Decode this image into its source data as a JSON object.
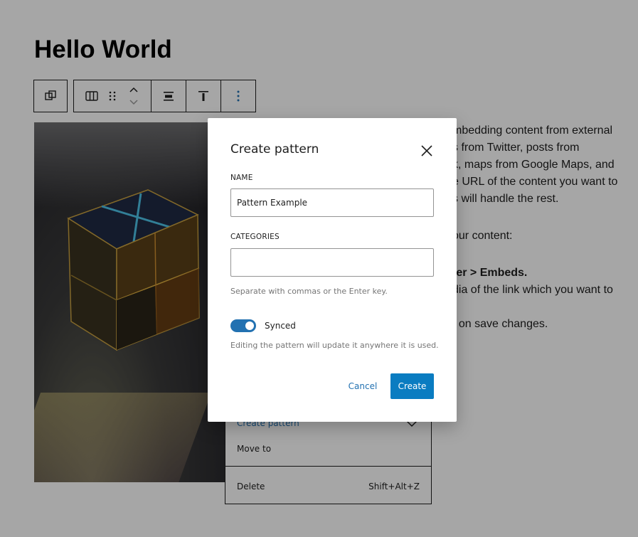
{
  "post": {
    "title": "Hello World",
    "text_lines": [
      "mbedding content from external",
      "s from Twitter, posts from",
      "k, maps from Google Maps, and",
      "e URL of the content you want to",
      "s will handle the rest.",
      "our content:",
      "ter > Embeds.",
      "dia of the link which you want to",
      "t on save changes."
    ]
  },
  "toolbar": {
    "icons": [
      "duplicate-icon",
      "columns-icon",
      "drag-handle-icon",
      "move-up-down-icon",
      "align-center-icon",
      "align-top-icon",
      "more-options-icon"
    ]
  },
  "menu": {
    "items": [
      {
        "label": "Create pattern",
        "shortcut": ""
      },
      {
        "label": "Move to",
        "shortcut": ""
      },
      {
        "label": "Delete",
        "shortcut": "Shift+Alt+Z"
      }
    ]
  },
  "modal": {
    "title": "Create pattern",
    "name_label": "NAME",
    "name_value": "Pattern Example",
    "categories_label": "CATEGORIES",
    "categories_value": "",
    "categories_help": "Separate with commas or the Enter key.",
    "synced_label": "Synced",
    "synced_on": true,
    "synced_help": "Editing the pattern will update it anywhere it is used.",
    "cancel_label": "Cancel",
    "create_label": "Create"
  },
  "colors": {
    "accent": "#2271b1",
    "primary_button": "#0a7cc1"
  }
}
